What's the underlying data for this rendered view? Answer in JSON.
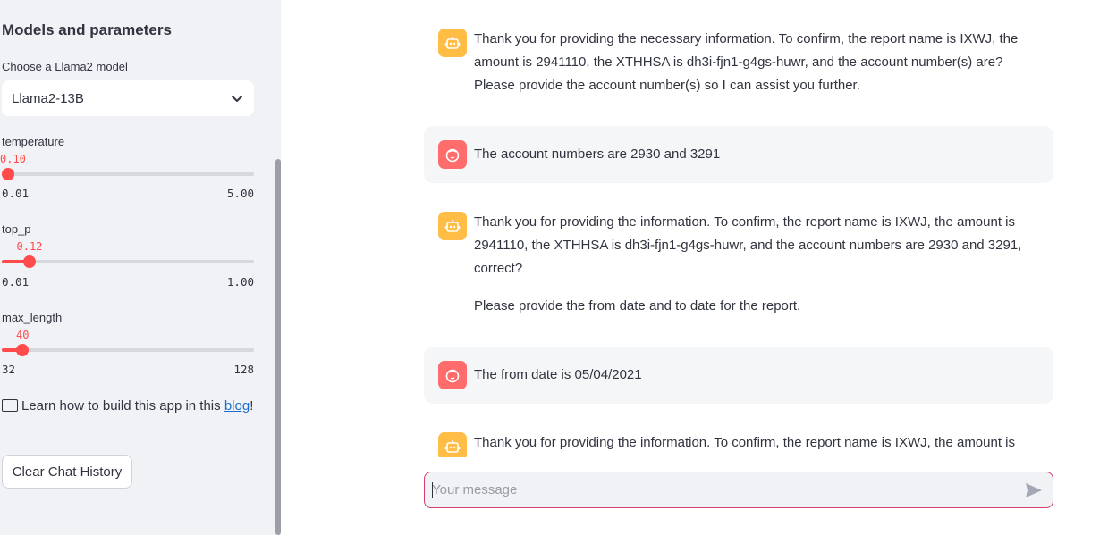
{
  "sidebar": {
    "title": "Models and parameters",
    "model_label": "Choose a Llama2 model",
    "model_value": "Llama2-13B",
    "sliders": [
      {
        "label": "temperature",
        "value": "0.10",
        "min": "0.01",
        "max": "5.00",
        "fraction": 0.018
      },
      {
        "label": "top_p",
        "value": "0.12",
        "min": "0.01",
        "max": "1.00",
        "fraction": 0.111
      },
      {
        "label": "max_length",
        "value": "40",
        "min": "32",
        "max": "128",
        "fraction": 0.083
      }
    ],
    "info_text": "Learn how to build this app in this",
    "info_link": "blog",
    "info_suffix": "!",
    "clear_button": "Clear Chat History"
  },
  "chat": {
    "messages": [
      {
        "role": "assistant",
        "paragraphs": [
          "Thank you for providing the necessary information. To confirm, the report name is IXWJ, the amount is 2941110, the XTHHSA is dh3i-fjn1-g4gs-huwr, and the account number(s) are? Please provide the account number(s) so I can assist you further."
        ]
      },
      {
        "role": "user",
        "paragraphs": [
          "The account numbers are 2930 and 3291"
        ]
      },
      {
        "role": "assistant",
        "paragraphs": [
          "Thank you for providing the information. To confirm, the report name is IXWJ, the amount is 2941110, the XTHHSA is dh3i-fjn1-g4gs-huwr, and the account numbers are 2930 and 3291, correct?",
          "Please provide the from date and to date for the report."
        ]
      },
      {
        "role": "user",
        "paragraphs": [
          "The from date is 05/04/2021"
        ]
      },
      {
        "role": "assistant",
        "paragraphs": [
          "Thank you for providing the information. To confirm, the report name is IXWJ, the amount is"
        ]
      }
    ],
    "input_placeholder": "Your message"
  },
  "colors": {
    "accent": "#ff4b4b",
    "assistant_avatar": "#ffbd45",
    "user_avatar": "#ff6c6c",
    "input_border": "#d43f6b"
  },
  "icons": {
    "assistant_avatar": "robot-icon",
    "user_avatar": "user-face-icon",
    "select": "chevron-down-icon",
    "send": "send-icon",
    "info": "book-icon"
  }
}
